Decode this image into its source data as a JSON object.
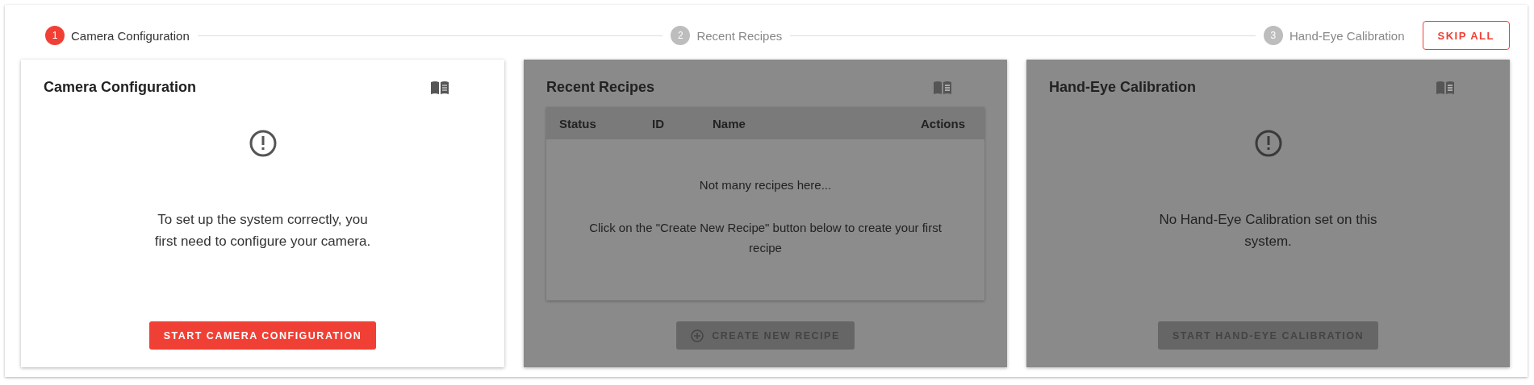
{
  "stepper": {
    "steps": [
      {
        "number": "1",
        "label": "Camera Configuration",
        "selected": true
      },
      {
        "number": "2",
        "label": "Recent Recipes",
        "selected": false
      },
      {
        "number": "3",
        "label": "Hand-Eye Calibration",
        "selected": false
      }
    ],
    "skip_button": "SKIP ALL"
  },
  "cards": [
    {
      "kind": "message",
      "title": "Camera Configuration",
      "disabled": false,
      "message": "To set up the system correctly, you first need to configure your camera.",
      "button": "START CAMERA CONFIGURATION"
    },
    {
      "kind": "table",
      "title": "Recent Recipes",
      "disabled": true,
      "columns": [
        "Status",
        "ID",
        "Name",
        "Actions"
      ],
      "empty_title": "Not many recipes here...",
      "empty_hint": "Click on the \"Create New Recipe\" button below to create your first recipe",
      "button": "CREATE NEW RECIPE"
    },
    {
      "kind": "message",
      "title": "Hand-Eye Calibration",
      "disabled": true,
      "message": "No Hand-Eye Calibration set on this system.",
      "button": "START HAND-EYE CALIBRATION"
    }
  ]
}
